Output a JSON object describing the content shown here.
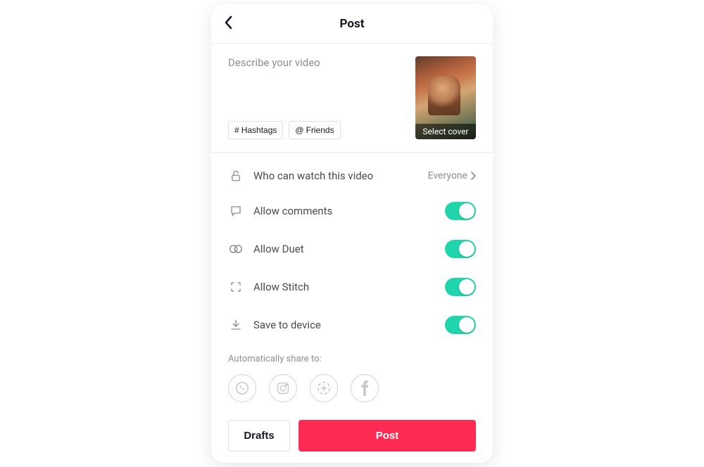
{
  "header": {
    "title": "Post"
  },
  "compose": {
    "placeholder": "Describe your video",
    "hashtags_label": "Hashtags",
    "friends_label": "Friends",
    "cover_label": "Select cover"
  },
  "settings": {
    "privacy": {
      "label": "Who can watch this video",
      "value": "Everyone"
    },
    "comments": {
      "label": "Allow comments",
      "on": true
    },
    "duet": {
      "label": "Allow Duet",
      "on": true
    },
    "stitch": {
      "label": "Allow Stitch",
      "on": true
    },
    "save": {
      "label": "Save to device",
      "on": true
    }
  },
  "share": {
    "label": "Automatically share to:",
    "targets": [
      "whatsapp",
      "instagram",
      "status",
      "facebook"
    ]
  },
  "footer": {
    "drafts": "Drafts",
    "post": "Post"
  }
}
